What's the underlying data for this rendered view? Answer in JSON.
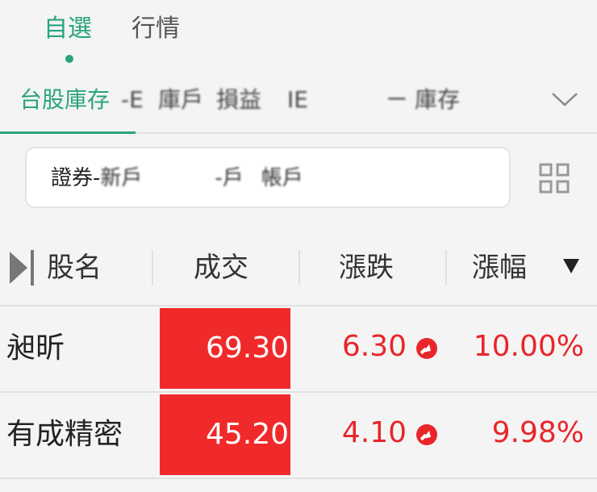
{
  "top_tabs": [
    {
      "label": "自選",
      "active": true
    },
    {
      "label": "行情",
      "active": false
    }
  ],
  "sub_tabs": {
    "active_label": "台股庫存",
    "blurred_tail": [
      "‑E",
      "庫戶",
      "損益",
      "IE",
      "ㄧ",
      "庫存"
    ]
  },
  "account": {
    "label": "證券-",
    "blurred_a": "新戶",
    "blurred_b": "-戶",
    "blurred_c": "帳戶"
  },
  "table": {
    "headers": {
      "name": "股名",
      "price": "成交",
      "change": "漲跌",
      "percent": "漲幅"
    },
    "sort_indicator": "descending",
    "rows": [
      {
        "name": "昶昕",
        "price": "69.30",
        "change": "6.30",
        "percent": "10.00%"
      },
      {
        "name": "有成精密",
        "price": "45.20",
        "change": "4.10",
        "percent": "9.98%"
      }
    ]
  },
  "colors": {
    "accent": "#2aa37e",
    "up": "#e8262a",
    "limit_up_bg": "#f02a2a"
  }
}
